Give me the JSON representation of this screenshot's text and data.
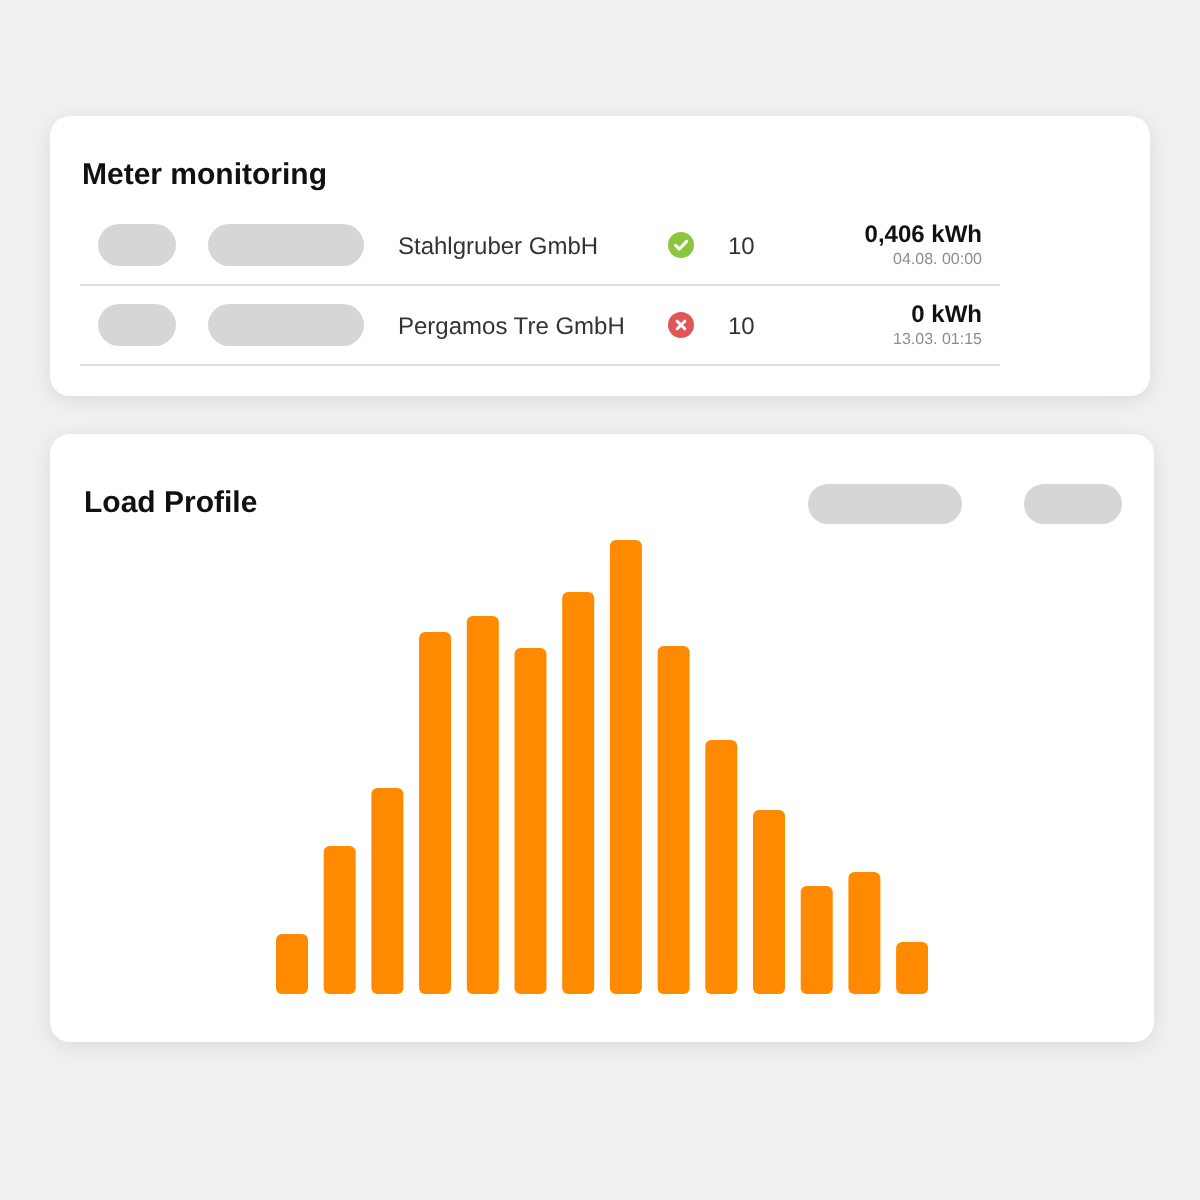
{
  "meter_monitoring": {
    "title": "Meter monitoring",
    "rows": [
      {
        "company": "Stahlgruber GmbH",
        "ok": true,
        "count": "10",
        "energy": "0,406 kWh",
        "timestamp": "04.08. 00:00"
      },
      {
        "company": "Pergamos Tre GmbH",
        "ok": false,
        "count": "10",
        "energy": "0 kWh",
        "timestamp": "13.03. 01:15"
      }
    ]
  },
  "load_profile": {
    "title": "Load Profile"
  }
}
